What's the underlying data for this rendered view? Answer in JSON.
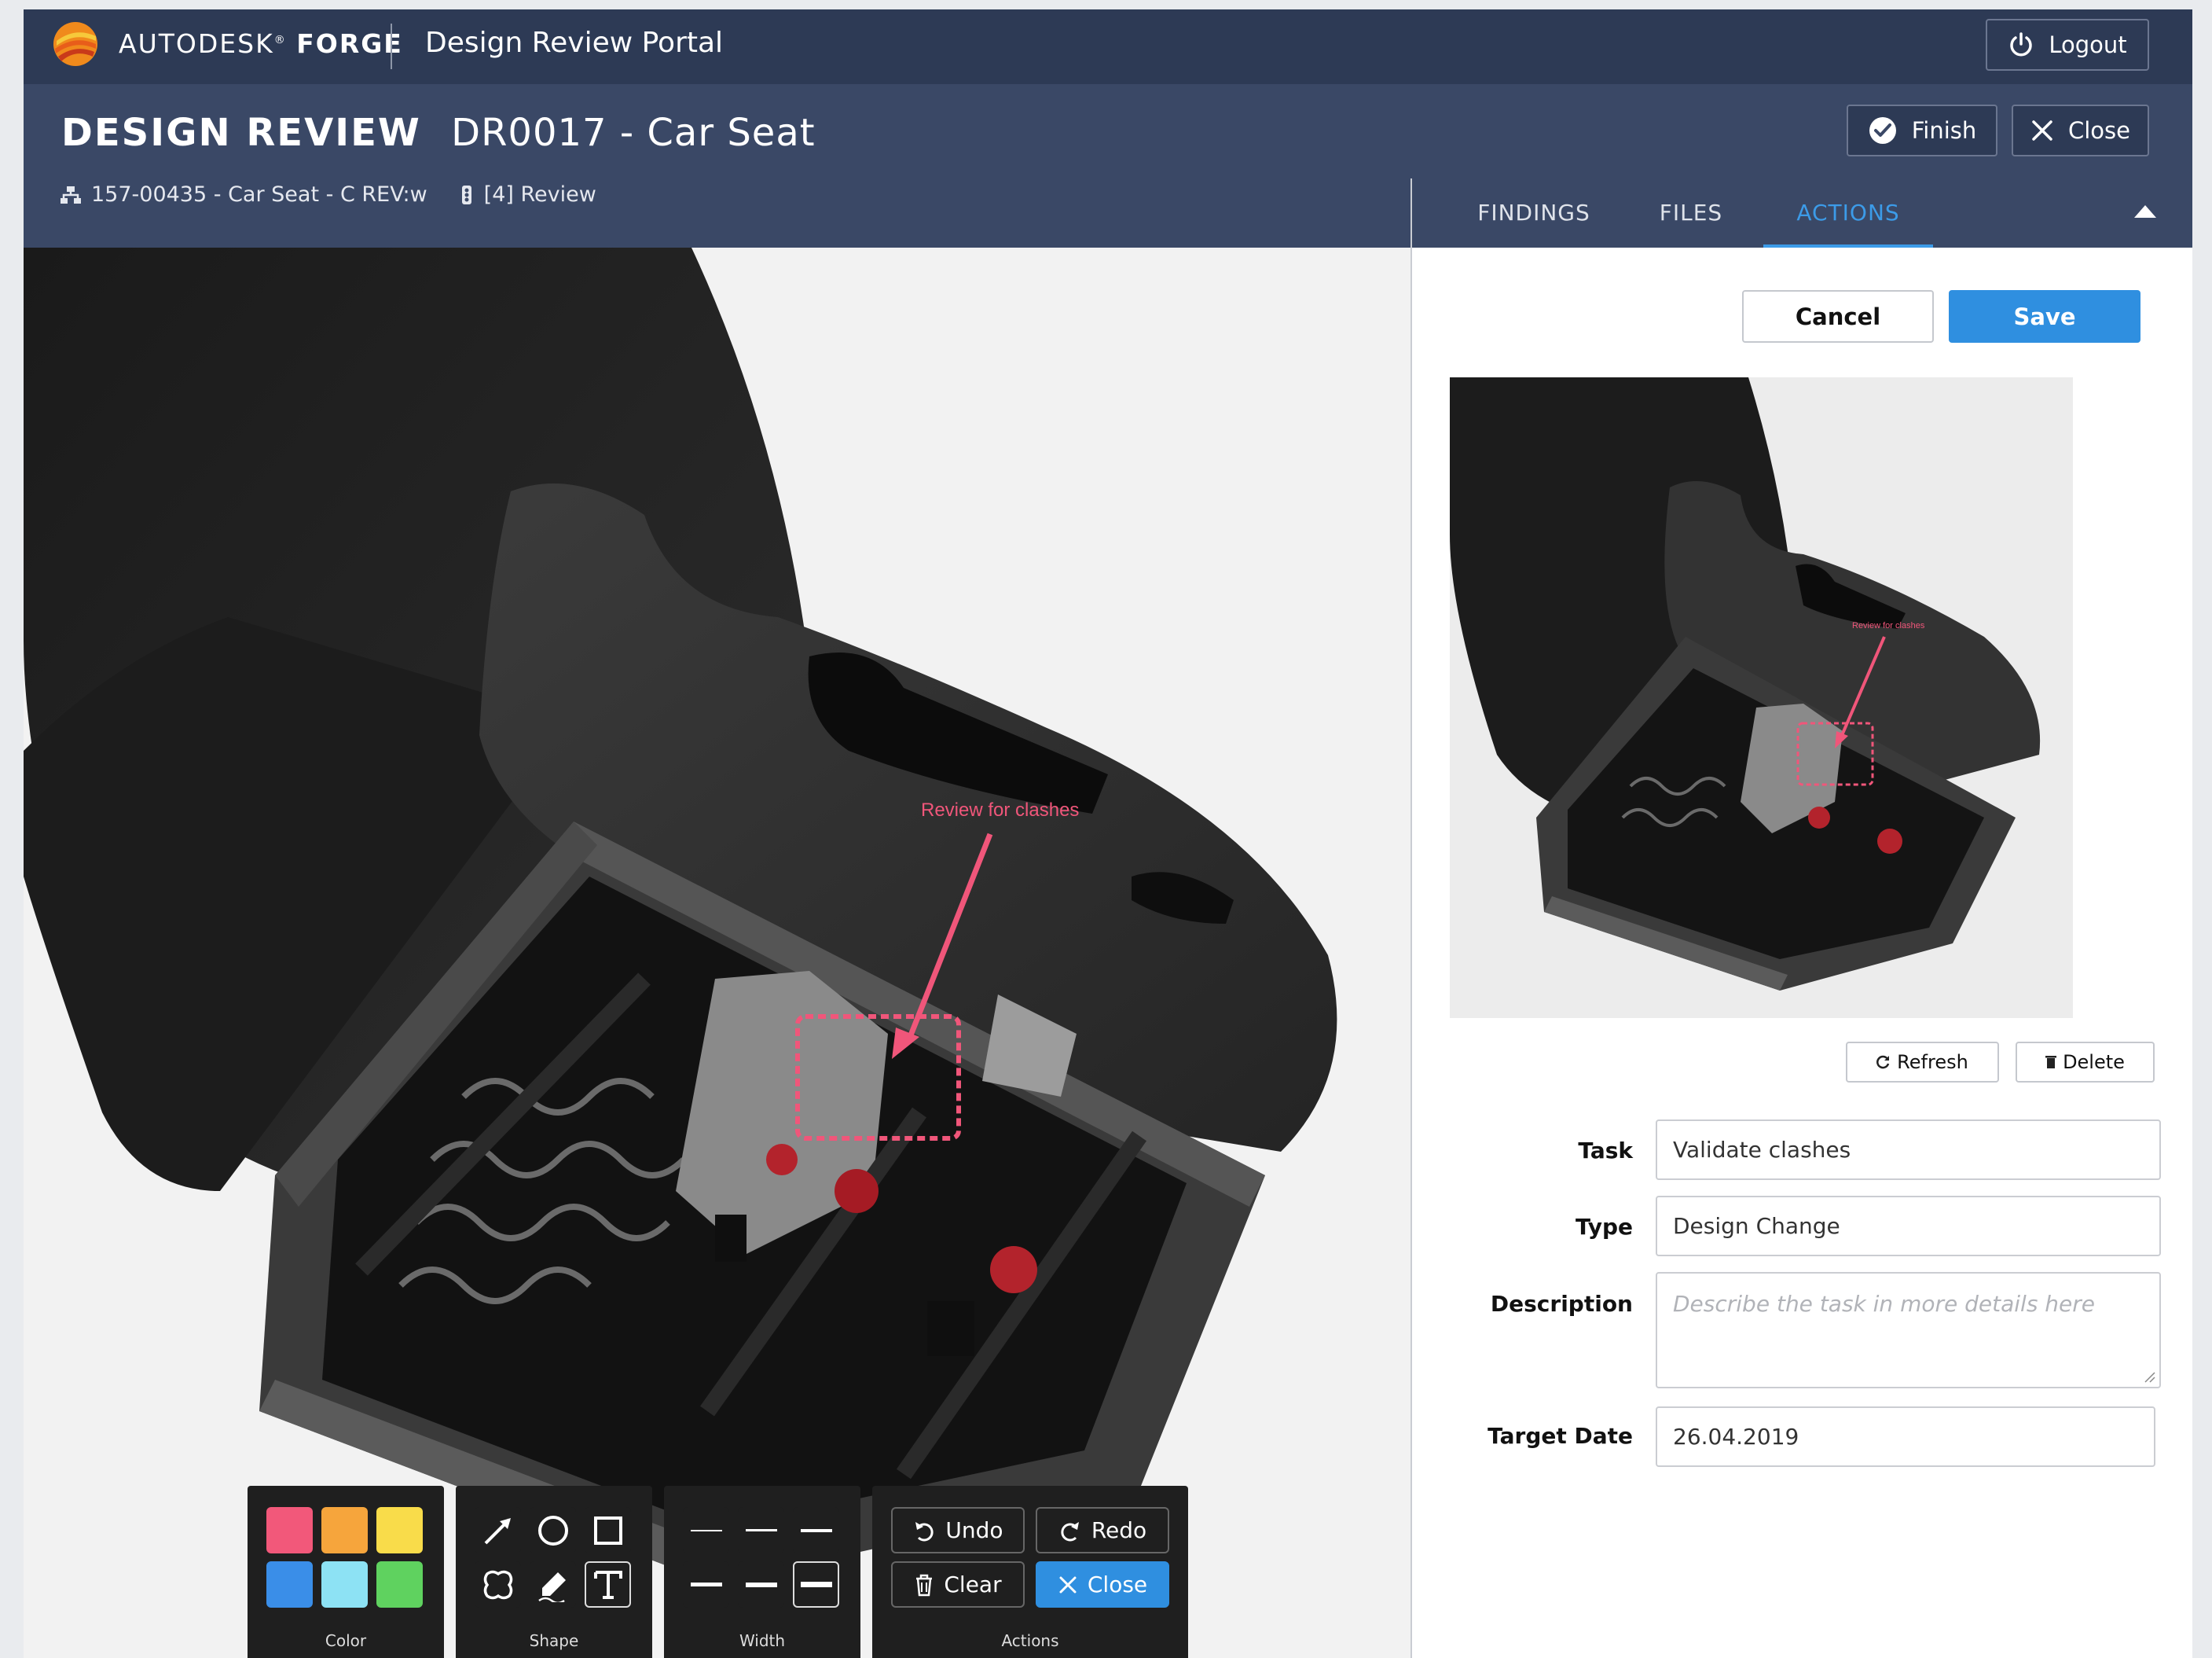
{
  "app": {
    "brand_name": "AUTODESK",
    "brand_product": "FORGE",
    "portal_title": "Design Review Portal",
    "logout_label": "Logout"
  },
  "header": {
    "kind": "DESIGN REVIEW",
    "title": "DR0017 - Car Seat",
    "part": "157-00435 - Car Seat - C REV:w",
    "status": "[4] Review",
    "finish_label": "Finish",
    "close_label": "Close"
  },
  "viewer": {
    "annotation_text": "Review for clashes",
    "annotation_color": "#f0567a"
  },
  "panel": {
    "tabs": [
      {
        "label": "FINDINGS"
      },
      {
        "label": "FILES"
      },
      {
        "label": "ACTIONS"
      }
    ],
    "active_tab": "ACTIONS",
    "cancel_label": "Cancel",
    "save_label": "Save",
    "refresh_label": "Refresh",
    "delete_label": "Delete",
    "thumb_annotation": "Review for clashes",
    "form": {
      "task_label": "Task",
      "task_value": "Validate clashes",
      "type_label": "Type",
      "type_value": "Design Change",
      "description_label": "Description",
      "description_placeholder": "Describe the task in more details here",
      "date_label": "Target Date",
      "date_value": "26.04.2019"
    }
  },
  "toolbar": {
    "color_caption": "Color",
    "shape_caption": "Shape",
    "width_caption": "Width",
    "actions_caption": "Actions",
    "colors": [
      "#f2587a",
      "#f6a53c",
      "#f9dc4a",
      "#3a8ee8",
      "#8de2f4",
      "#5fd25f"
    ],
    "undo_label": "Undo",
    "redo_label": "Redo",
    "clear_label": "Clear",
    "close_label": "Close"
  }
}
